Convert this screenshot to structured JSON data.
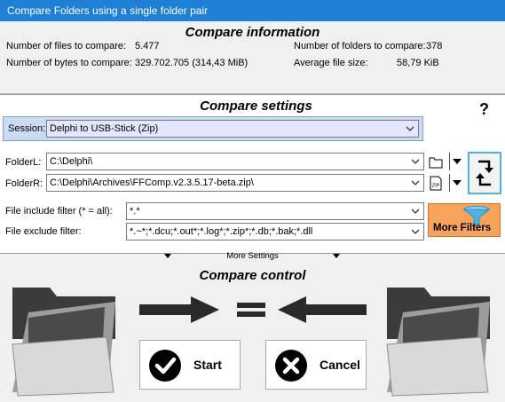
{
  "window": {
    "title": "Compare Folders using a single folder pair"
  },
  "info": {
    "title": "Compare information",
    "files_label": "Number of files to compare:",
    "files_value": "5.477",
    "bytes_label": "Number of bytes to compare:",
    "bytes_value": "329.702.705  (314,43 MiB)",
    "folders_label": "Number of folders to compare:",
    "folders_value": "378",
    "avg_label": "Average file size:",
    "avg_value": "58,79 KiB"
  },
  "settings": {
    "title": "Compare settings",
    "help": "?",
    "session_label": "Session:",
    "session_value": "Delphi to USB-Stick (Zip)",
    "folderL_label": "FolderL:",
    "folderL_value": "C:\\Delphi\\",
    "folderR_label": "FolderR:",
    "folderR_value": "C:\\Delphi\\Archives\\FFComp.v2.3.5.17-beta.zip\\",
    "include_label": "File include filter (* = all):",
    "include_value": "*.*",
    "exclude_label": "File exclude filter:",
    "exclude_value": "*.~*;*.dcu;*.out*;*.log*;*.zip*;*.db;*.bak;*.dll",
    "more_filters": "More Filters",
    "zip_badge": "ZIP",
    "more_settings": "More Settings"
  },
  "control": {
    "title": "Compare control",
    "start": "Start",
    "cancel": "Cancel"
  },
  "colors": {
    "titlebar": "#1e7fd4",
    "session_bg": "#cbdcf2",
    "more_filters_bg": "#f7a35c",
    "funnel": "#4fb3e6"
  }
}
